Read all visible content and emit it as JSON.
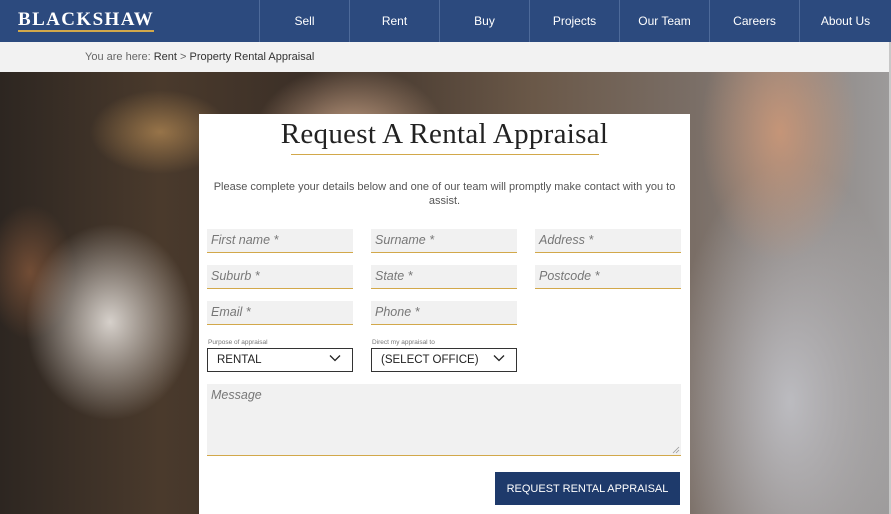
{
  "header": {
    "logo": "BLACKSHAW",
    "nav": [
      "Sell",
      "Rent",
      "Buy",
      "Projects",
      "Our Team",
      "Careers",
      "About Us"
    ]
  },
  "breadcrumb": {
    "prefix": "You are here:",
    "items": [
      "Rent",
      ">",
      "Property Rental Appraisal"
    ]
  },
  "form": {
    "title": "Request A Rental Appraisal",
    "intro": "Please complete your details below and one of our team will promptly make contact with you to assist.",
    "fields": {
      "first_name": "First name *",
      "surname": "Surname *",
      "address": "Address *",
      "suburb": "Suburb *",
      "state": "State *",
      "postcode": "Postcode *",
      "email": "Email *",
      "phone": "Phone *",
      "message": "Message"
    },
    "purpose": {
      "label": "Purpose of appraisal",
      "value": "RENTAL"
    },
    "office": {
      "label": "Direct my appraisal to",
      "value": "(SELECT OFFICE)"
    },
    "submit": "REQUEST RENTAL APPRAISAL"
  },
  "colors": {
    "header": "#2c4a7e",
    "accent": "#d2a84a",
    "button": "#1e3a6b"
  }
}
